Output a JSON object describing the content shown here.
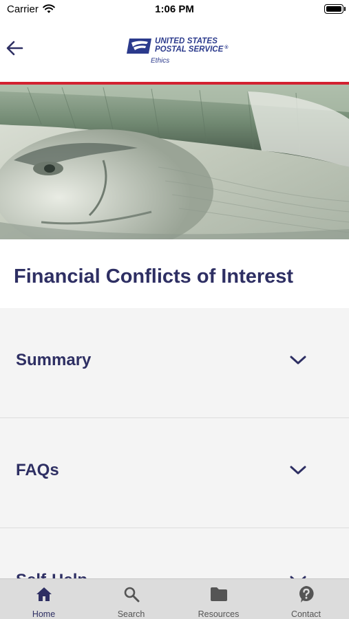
{
  "status_bar": {
    "carrier": "Carrier",
    "time": "1:06 PM"
  },
  "header": {
    "back_icon": "arrow-left-icon",
    "logo_line1": "UNITED STATES",
    "logo_line2": "POSTAL SERVICE",
    "logo_registered": "®",
    "logo_subtitle": "Ethics"
  },
  "colors": {
    "brand_navy": "#2e2f63",
    "accent_red": "#d32030",
    "logo_blue": "#2b3a8c",
    "accordion_bg": "#f4f4f4",
    "tabbar_bg": "#dcdcdc"
  },
  "page": {
    "title": "Financial Conflicts of Interest"
  },
  "accordion": {
    "sections": [
      {
        "label": "Summary",
        "icon": "chevron-down-icon"
      },
      {
        "label": "FAQs",
        "icon": "chevron-down-icon"
      },
      {
        "label": "Self-Help",
        "icon": "chevron-down-icon"
      }
    ]
  },
  "tabbar": {
    "tabs": [
      {
        "label": "Home",
        "icon": "home-icon",
        "active": true
      },
      {
        "label": "Search",
        "icon": "search-icon",
        "active": false
      },
      {
        "label": "Resources",
        "icon": "folder-icon",
        "active": false
      },
      {
        "label": "Contact",
        "icon": "help-icon",
        "active": false
      }
    ]
  }
}
